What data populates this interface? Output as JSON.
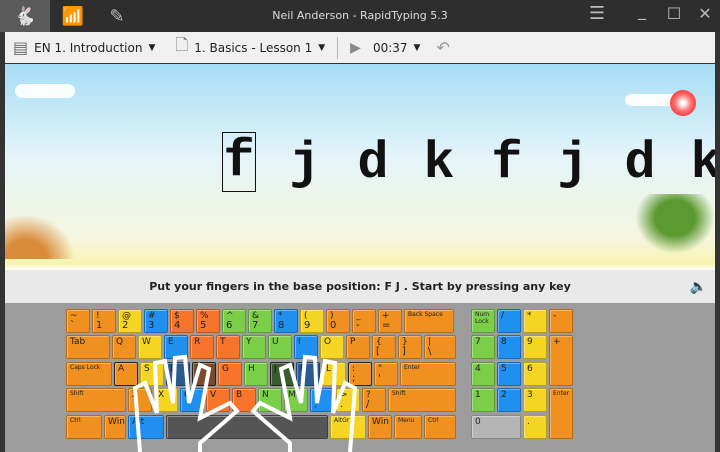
{
  "titlebar": {
    "title": "Neil Anderson - RapidTyping 5.3",
    "tabs": [
      "rabbit-icon",
      "stats-icon",
      "editor-icon"
    ]
  },
  "toolbar": {
    "course": "EN 1. Introduction",
    "lesson": "1. Basics - Lesson 1",
    "time": "00:37"
  },
  "exercise": {
    "letters": [
      "f",
      "j",
      "d",
      "k",
      "f",
      "j",
      "d",
      "k"
    ],
    "current_index": 0
  },
  "instruction": "Put your fingers in the base position:  F J .  Start by pressing any key",
  "colors": {
    "O": "#f0901e",
    "R": "#f7742a",
    "Y": "#f4d523",
    "B": "#1f8ff0",
    "G": "#7bcf48",
    "D": "#2a5a8e",
    "F": "#7a4a2a",
    "J": "#3a5a30",
    "S": "#555555",
    "Z": "#b5b5b5"
  },
  "keyboard": {
    "rows": [
      [
        [
          "~",
          "`",
          "O"
        ],
        [
          "!",
          "1",
          "O"
        ],
        [
          "@",
          "2",
          "Y"
        ],
        [
          "#",
          "3",
          "B"
        ],
        [
          "$",
          "4",
          "R"
        ],
        [
          "%",
          "5",
          "R"
        ],
        [
          "^",
          "6",
          "G"
        ],
        [
          "&",
          "7",
          "G"
        ],
        [
          "*",
          "8",
          "B"
        ],
        [
          "(",
          "9",
          "Y"
        ],
        [
          ")",
          "0",
          "O"
        ],
        [
          "_",
          "-",
          "O"
        ],
        [
          "+",
          "=",
          "O"
        ],
        [
          "Back Space",
          "",
          "O"
        ]
      ],
      [
        [
          "Tab",
          "",
          "O"
        ],
        [
          "Q",
          "",
          "O"
        ],
        [
          "W",
          "",
          "Y"
        ],
        [
          "E",
          "",
          "B"
        ],
        [
          "R",
          "",
          "R"
        ],
        [
          "T",
          "",
          "R"
        ],
        [
          "Y",
          "",
          "G"
        ],
        [
          "U",
          "",
          "G"
        ],
        [
          "I",
          "",
          "B"
        ],
        [
          "O",
          "",
          "Y"
        ],
        [
          "P",
          "",
          "O"
        ],
        [
          "{",
          "[",
          "O"
        ],
        [
          "}",
          "]",
          "O"
        ],
        [
          "|",
          "\\",
          "O"
        ]
      ],
      [
        [
          "Caps Lock",
          "",
          "O"
        ],
        [
          "A",
          "",
          "O"
        ],
        [
          "S",
          "",
          "Y"
        ],
        [
          "D",
          "",
          "D"
        ],
        [
          "F",
          "",
          "F"
        ],
        [
          "G",
          "",
          "R"
        ],
        [
          "H",
          "",
          "G"
        ],
        [
          "J",
          "",
          "J"
        ],
        [
          "K",
          "",
          "D"
        ],
        [
          "L",
          "",
          "Y"
        ],
        [
          ":",
          ";",
          "O"
        ],
        [
          "\"",
          "'",
          "O"
        ],
        [
          "Enter",
          "",
          "O"
        ]
      ],
      [
        [
          "Shift",
          "",
          "O"
        ],
        [
          "Z",
          "",
          "O"
        ],
        [
          "X",
          "",
          "Y"
        ],
        [
          "C",
          "",
          "B"
        ],
        [
          "V",
          "",
          "R"
        ],
        [
          "B",
          "",
          "R"
        ],
        [
          "N",
          "",
          "G"
        ],
        [
          "M",
          "",
          "G"
        ],
        [
          "<",
          ",",
          "B"
        ],
        [
          ">",
          ".",
          "Y"
        ],
        [
          "?",
          "/",
          "O"
        ],
        [
          "Shift",
          "",
          "O"
        ]
      ],
      [
        [
          "Ctrl",
          "",
          "O"
        ],
        [
          "Win",
          "",
          "O"
        ],
        [
          "Alt",
          "",
          "B"
        ],
        [
          "",
          "",
          "S"
        ],
        [
          "AltGr",
          "",
          "Y"
        ],
        [
          "Win",
          "",
          "O"
        ],
        [
          "Menu",
          "",
          "O"
        ],
        [
          "Ctrl",
          "",
          "O"
        ]
      ]
    ],
    "numpad": [
      [
        "Num Lock",
        "",
        "G"
      ],
      [
        "/",
        "",
        "B"
      ],
      [
        "*",
        "",
        "Y"
      ],
      [
        "-",
        "",
        "O"
      ],
      [
        "7",
        "",
        "G"
      ],
      [
        "8",
        "",
        "B"
      ],
      [
        "9",
        "",
        "Y"
      ],
      [
        "+",
        "",
        "O"
      ],
      [
        "4",
        "",
        "G"
      ],
      [
        "5",
        "",
        "B"
      ],
      [
        "6",
        "",
        "Y"
      ],
      [
        "1",
        "",
        "G"
      ],
      [
        "2",
        "",
        "B"
      ],
      [
        "3",
        "",
        "Y"
      ],
      [
        "Enter",
        "",
        "O"
      ],
      [
        "0",
        "",
        "Z"
      ],
      [
        ".",
        "",
        "Y"
      ]
    ]
  }
}
